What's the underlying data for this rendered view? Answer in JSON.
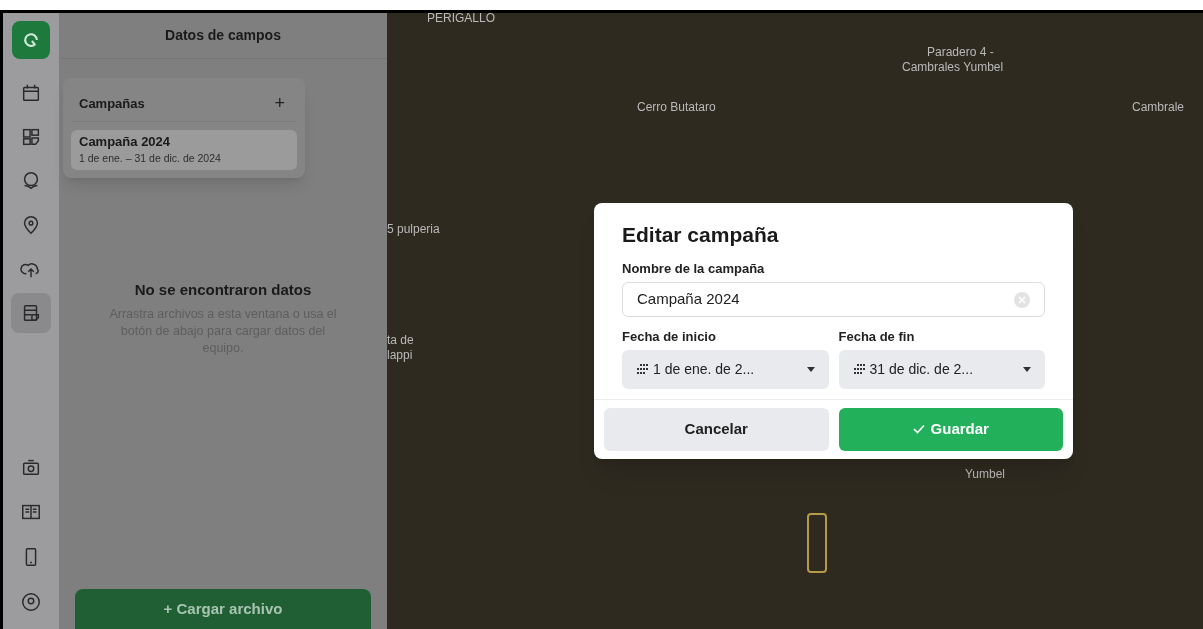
{
  "rail": {
    "top_items": [
      {
        "selected": false
      },
      {
        "selected": false
      },
      {
        "selected": false
      },
      {
        "selected": false
      },
      {
        "selected": false
      },
      {
        "selected": true
      }
    ]
  },
  "panel": {
    "title": "Datos de campos",
    "empty_title": "No se encontraron datos",
    "empty_text": "Arrastra archivos a esta ventana o usa el botón de abajo para cargar datos del equipo.",
    "upload_button": "+ Cargar archivo"
  },
  "campaigns_popover": {
    "title": "Campañas",
    "add": "+",
    "items": [
      {
        "name": "Campaña 2024",
        "dates": "1 de ene. – 31 de dic. de 2024",
        "selected": true
      }
    ]
  },
  "map": {
    "labels": [
      "PERIGALLO",
      "Paradero 4 -",
      "Cambrales Yumbel",
      "Cerro Butataro",
      "Cambrale",
      "5 pulperia",
      "ta de",
      "lappi",
      "Yumbel"
    ]
  },
  "dialog": {
    "title": "Editar campaña",
    "name_label": "Nombre de la campaña",
    "name_value": "Campaña 2024",
    "start_label": "Fecha de inicio",
    "start_value": "1 de ene. de 2...",
    "end_label": "Fecha de fin",
    "end_value": "31 de dic. de 2...",
    "cancel": "Cancelar",
    "save": "Guardar"
  }
}
